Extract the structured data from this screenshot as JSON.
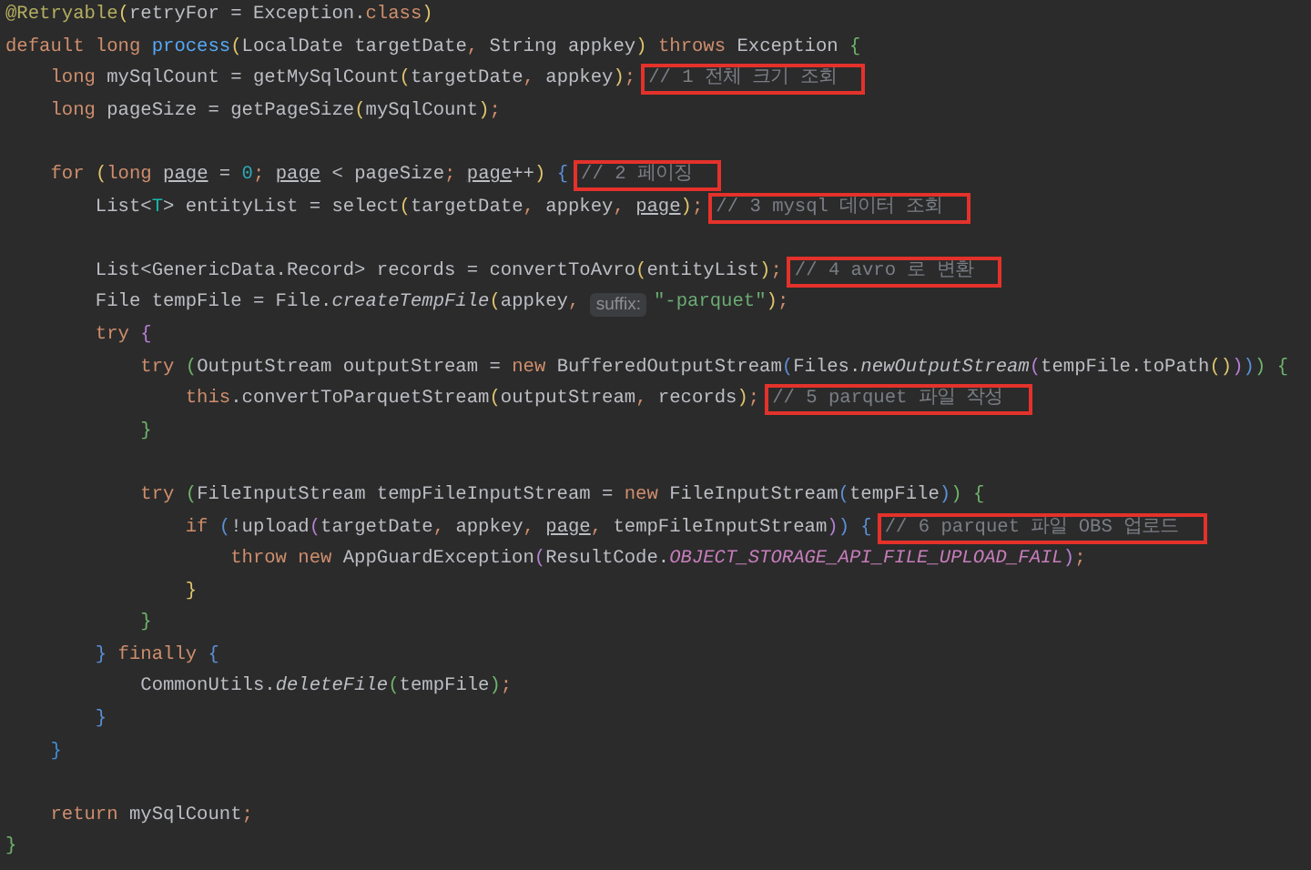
{
  "editor": {
    "lines": [
      {
        "tokens": [
          {
            "text": "@Retryable",
            "kind": "annotation"
          },
          {
            "text": "(",
            "kind": "bracket",
            "color": "#e0c46c"
          },
          {
            "text": "retryFor = Exception.",
            "kind": "plain"
          },
          {
            "text": "class",
            "kind": "keyword"
          },
          {
            "text": ")",
            "kind": "bracket",
            "color": "#e0c46c"
          }
        ]
      },
      {
        "tokens": [
          {
            "text": "default long ",
            "kind": "keyword"
          },
          {
            "text": "process",
            "kind": "declaration"
          },
          {
            "text": "(",
            "kind": "bracket",
            "color": "#e0c46c"
          },
          {
            "text": "LocalDate targetDate",
            "kind": "plain"
          },
          {
            "text": ", ",
            "kind": "punct"
          },
          {
            "text": "String appkey",
            "kind": "plain"
          },
          {
            "text": ")",
            "kind": "bracket",
            "color": "#e0c46c"
          },
          {
            "text": " throws ",
            "kind": "keyword"
          },
          {
            "text": "Exception ",
            "kind": "plain"
          },
          {
            "text": "{",
            "kind": "bracket",
            "color": "#6fb36b"
          }
        ]
      },
      {
        "tokens": [
          {
            "text": "    long ",
            "kind": "keyword"
          },
          {
            "text": "mySqlCount = getMySqlCount",
            "kind": "plain"
          },
          {
            "text": "(",
            "kind": "bracket",
            "color": "#e0c46c"
          },
          {
            "text": "targetDate",
            "kind": "plain"
          },
          {
            "text": ", ",
            "kind": "punct"
          },
          {
            "text": "appkey",
            "kind": "plain"
          },
          {
            "text": ")",
            "kind": "bracket",
            "color": "#e0c46c"
          },
          {
            "text": ";",
            "kind": "punct"
          },
          {
            "text": "// 1 전체 크기 조회",
            "kind": "comment",
            "highlighted": true
          }
        ]
      },
      {
        "tokens": [
          {
            "text": "    long ",
            "kind": "keyword"
          },
          {
            "text": "pageSize = getPageSize",
            "kind": "plain"
          },
          {
            "text": "(",
            "kind": "bracket",
            "color": "#e0c46c"
          },
          {
            "text": "mySqlCount",
            "kind": "plain"
          },
          {
            "text": ")",
            "kind": "bracket",
            "color": "#e0c46c"
          },
          {
            "text": ";",
            "kind": "punct"
          }
        ]
      },
      {
        "gap_before": true,
        "tokens": [
          {
            "text": "    for ",
            "kind": "keyword"
          },
          {
            "text": "(",
            "kind": "bracket",
            "color": "#e0c46c"
          },
          {
            "text": "long ",
            "kind": "keyword"
          },
          {
            "text": "page",
            "kind": "variable"
          },
          {
            "text": " = ",
            "kind": "plain"
          },
          {
            "text": "0",
            "kind": "number"
          },
          {
            "text": "; ",
            "kind": "punct"
          },
          {
            "text": "page",
            "kind": "variable"
          },
          {
            "text": " < pageSize",
            "kind": "plain"
          },
          {
            "text": "; ",
            "kind": "punct"
          },
          {
            "text": "page",
            "kind": "variable"
          },
          {
            "text": "++",
            "kind": "plain"
          },
          {
            "text": ")",
            "kind": "bracket",
            "color": "#e0c46c"
          },
          {
            "text": " {",
            "kind": "bracket",
            "color": "#5c8fd6"
          },
          {
            "text": "// 2 페이징",
            "kind": "comment",
            "highlighted": true
          }
        ]
      },
      {
        "tokens": [
          {
            "text": "        List<",
            "kind": "plain"
          },
          {
            "text": "T",
            "kind": "type-param"
          },
          {
            "text": "> entityList = select",
            "kind": "plain"
          },
          {
            "text": "(",
            "kind": "bracket",
            "color": "#e0c46c"
          },
          {
            "text": "targetDate",
            "kind": "plain"
          },
          {
            "text": ", ",
            "kind": "punct"
          },
          {
            "text": "appkey",
            "kind": "plain"
          },
          {
            "text": ", ",
            "kind": "punct"
          },
          {
            "text": "page",
            "kind": "variable"
          },
          {
            "text": ")",
            "kind": "bracket",
            "color": "#e0c46c"
          },
          {
            "text": ";",
            "kind": "punct"
          },
          {
            "text": "// 3 mysql 데이터 조회",
            "kind": "comment",
            "highlighted": true
          }
        ]
      },
      {
        "gap_before": true,
        "tokens": [
          {
            "text": "        List<GenericData.Record> records = convertToAvro",
            "kind": "plain"
          },
          {
            "text": "(",
            "kind": "bracket",
            "color": "#e0c46c"
          },
          {
            "text": "entityList",
            "kind": "plain"
          },
          {
            "text": ")",
            "kind": "bracket",
            "color": "#e0c46c"
          },
          {
            "text": ";",
            "kind": "punct"
          },
          {
            "text": "// 4 avro 로 변환",
            "kind": "comment",
            "highlighted": true
          }
        ]
      },
      {
        "tokens": [
          {
            "text": "        File tempFile = File.",
            "kind": "plain"
          },
          {
            "text": "createTempFile",
            "kind": "static"
          },
          {
            "text": "(",
            "kind": "bracket",
            "color": "#e0c46c"
          },
          {
            "text": "appkey",
            "kind": "plain"
          },
          {
            "text": ", ",
            "kind": "punct"
          },
          {
            "text": "suffix:",
            "kind": "hint"
          },
          {
            "text": "\"-parquet\"",
            "kind": "string"
          },
          {
            "text": ")",
            "kind": "bracket",
            "color": "#e0c46c"
          },
          {
            "text": ";",
            "kind": "punct"
          }
        ]
      },
      {
        "tokens": [
          {
            "text": "        try ",
            "kind": "keyword"
          },
          {
            "text": "{",
            "kind": "bracket",
            "color": "#b47fd3"
          }
        ]
      },
      {
        "tokens": [
          {
            "text": "            try ",
            "kind": "keyword"
          },
          {
            "text": "(",
            "kind": "bracket",
            "color": "#6fb36b"
          },
          {
            "text": "OutputStream outputStream = ",
            "kind": "plain"
          },
          {
            "text": "new ",
            "kind": "keyword"
          },
          {
            "text": "BufferedOutputStream",
            "kind": "plain"
          },
          {
            "text": "(",
            "kind": "bracket",
            "color": "#5c8fd6"
          },
          {
            "text": "Files.",
            "kind": "plain"
          },
          {
            "text": "newOutputStream",
            "kind": "static"
          },
          {
            "text": "(",
            "kind": "bracket",
            "color": "#b47fd3"
          },
          {
            "text": "tempFile.toPath",
            "kind": "plain"
          },
          {
            "text": "()",
            "kind": "bracket",
            "color": "#e0c46c"
          },
          {
            "text": ")",
            "kind": "bracket",
            "color": "#b47fd3"
          },
          {
            "text": ")",
            "kind": "bracket",
            "color": "#5c8fd6"
          },
          {
            "text": ")",
            "kind": "bracket",
            "color": "#6fb36b"
          },
          {
            "text": " {",
            "kind": "bracket",
            "color": "#6fb36b"
          }
        ]
      },
      {
        "tokens": [
          {
            "text": "                this",
            "kind": "keyword"
          },
          {
            "text": ".convertToParquetStream",
            "kind": "plain"
          },
          {
            "text": "(",
            "kind": "bracket",
            "color": "#e0c46c"
          },
          {
            "text": "outputStream",
            "kind": "plain"
          },
          {
            "text": ", ",
            "kind": "punct"
          },
          {
            "text": "records",
            "kind": "plain"
          },
          {
            "text": ")",
            "kind": "bracket",
            "color": "#e0c46c"
          },
          {
            "text": ";",
            "kind": "punct"
          },
          {
            "text": "// 5 parquet 파일 작성",
            "kind": "comment",
            "highlighted": true
          }
        ]
      },
      {
        "tokens": [
          {
            "text": "            }",
            "kind": "bracket",
            "color": "#6fb36b"
          }
        ]
      },
      {
        "gap_before": true,
        "tokens": [
          {
            "text": "            try ",
            "kind": "keyword"
          },
          {
            "text": "(",
            "kind": "bracket",
            "color": "#6fb36b"
          },
          {
            "text": "FileInputStream tempFileInputStream = ",
            "kind": "plain"
          },
          {
            "text": "new ",
            "kind": "keyword"
          },
          {
            "text": "FileInputStream",
            "kind": "plain"
          },
          {
            "text": "(",
            "kind": "bracket",
            "color": "#5c8fd6"
          },
          {
            "text": "tempFile",
            "kind": "plain"
          },
          {
            "text": ")",
            "kind": "bracket",
            "color": "#5c8fd6"
          },
          {
            "text": ")",
            "kind": "bracket",
            "color": "#6fb36b"
          },
          {
            "text": " {",
            "kind": "bracket",
            "color": "#6fb36b"
          }
        ]
      },
      {
        "tokens": [
          {
            "text": "                if ",
            "kind": "keyword"
          },
          {
            "text": "(",
            "kind": "bracket",
            "color": "#5c8fd6"
          },
          {
            "text": "!upload",
            "kind": "plain"
          },
          {
            "text": "(",
            "kind": "bracket",
            "color": "#b47fd3"
          },
          {
            "text": "targetDate",
            "kind": "plain"
          },
          {
            "text": ", ",
            "kind": "punct"
          },
          {
            "text": "appkey",
            "kind": "plain"
          },
          {
            "text": ", ",
            "kind": "punct"
          },
          {
            "text": "page",
            "kind": "variable"
          },
          {
            "text": ", ",
            "kind": "punct"
          },
          {
            "text": "tempFileInputStream",
            "kind": "plain"
          },
          {
            "text": ")",
            "kind": "bracket",
            "color": "#b47fd3"
          },
          {
            "text": ")",
            "kind": "bracket",
            "color": "#5c8fd6"
          },
          {
            "text": " {",
            "kind": "bracket",
            "color": "#5c8fd6"
          },
          {
            "text": "// 6 parquet 파일 OBS 업로드",
            "kind": "comment",
            "highlighted": true
          }
        ]
      },
      {
        "tokens": [
          {
            "text": "                    throw new ",
            "kind": "keyword"
          },
          {
            "text": "AppGuardException",
            "kind": "plain"
          },
          {
            "text": "(",
            "kind": "bracket",
            "color": "#b47fd3"
          },
          {
            "text": "ResultCode.",
            "kind": "plain"
          },
          {
            "text": "OBJECT_STORAGE_API_FILE_UPLOAD_FAIL",
            "kind": "constant"
          },
          {
            "text": ")",
            "kind": "bracket",
            "color": "#b47fd3"
          },
          {
            "text": ";",
            "kind": "punct"
          }
        ]
      },
      {
        "tokens": [
          {
            "text": "                }",
            "kind": "bracket",
            "color": "#e0c46c"
          }
        ]
      },
      {
        "tokens": [
          {
            "text": "            }",
            "kind": "bracket",
            "color": "#6fb36b"
          }
        ]
      },
      {
        "tokens": [
          {
            "text": "        } ",
            "kind": "bracket",
            "color": "#5c8fd6"
          },
          {
            "text": "finally ",
            "kind": "keyword"
          },
          {
            "text": "{",
            "kind": "bracket",
            "color": "#5c8fd6"
          }
        ]
      },
      {
        "tokens": [
          {
            "text": "            CommonUtils.",
            "kind": "plain"
          },
          {
            "text": "deleteFile",
            "kind": "static"
          },
          {
            "text": "(",
            "kind": "bracket",
            "color": "#6fb36b"
          },
          {
            "text": "tempFile",
            "kind": "plain"
          },
          {
            "text": ")",
            "kind": "bracket",
            "color": "#6fb36b"
          },
          {
            "text": ";",
            "kind": "punct"
          }
        ]
      },
      {
        "tokens": [
          {
            "text": "        }",
            "kind": "bracket",
            "color": "#5c8fd6"
          }
        ]
      },
      {
        "tokens": [
          {
            "text": "    }",
            "kind": "bracket",
            "color": "#3f8fd6"
          }
        ]
      },
      {
        "gap_before": true,
        "tokens": [
          {
            "text": "    return ",
            "kind": "keyword"
          },
          {
            "text": "mySqlCount",
            "kind": "plain"
          },
          {
            "text": ";",
            "kind": "punct"
          }
        ]
      },
      {
        "tokens": [
          {
            "text": "}",
            "kind": "bracket",
            "color": "#6fb36b"
          }
        ]
      }
    ]
  }
}
